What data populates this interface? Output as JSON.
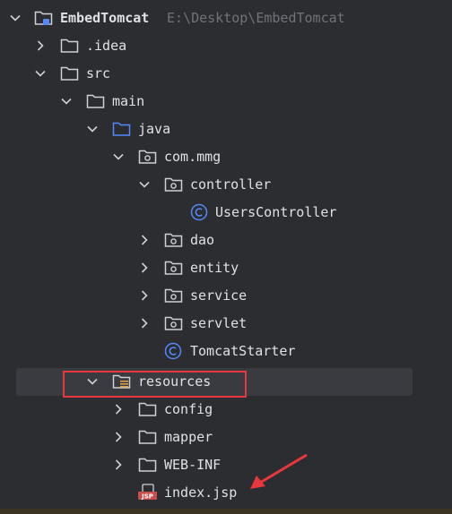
{
  "project": {
    "name": "EmbedTomcat",
    "path": "E:\\Desktop\\EmbedTomcat"
  },
  "tree": {
    "idea": ".idea",
    "src": "src",
    "main": "main",
    "java": "java",
    "package": "com.mmg",
    "controller": "controller",
    "users_controller": "UsersController",
    "dao": "dao",
    "entity": "entity",
    "service": "service",
    "servlet": "servlet",
    "tomcat_starter": "TomcatStarter",
    "resources": "resources",
    "config": "config",
    "mapper": "mapper",
    "web_inf": "WEB-INF",
    "index_jsp": "index.jsp"
  },
  "icons": {
    "folder": "folder-icon",
    "package": "package-icon",
    "class": "class-icon",
    "source_root": "source-folder-icon",
    "resources_root": "resources-folder-icon",
    "jsp": "jsp-file-icon",
    "module": "module-icon"
  },
  "colors": {
    "background": "#2b2d30",
    "text": "#dfe1e5",
    "path_text": "#6f737a",
    "selection": "#393b40",
    "annotation_red": "#e8383d",
    "class_blue": "#548af7",
    "source_blue": "#548af7"
  }
}
